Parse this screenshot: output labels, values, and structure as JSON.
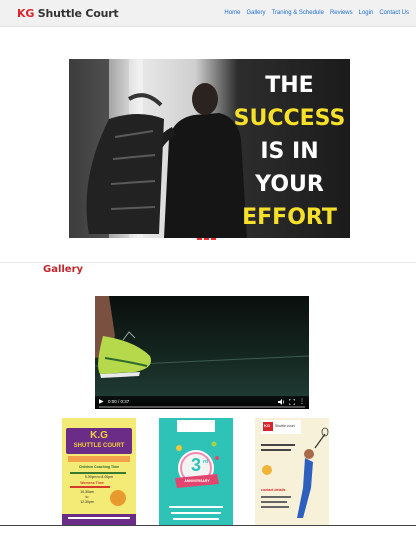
{
  "navbar": {
    "brand_kg": "KG",
    "brand_rest": " Shuttle Court",
    "links": [
      "Home",
      "Gallery",
      "Traning & Schedule",
      "Reviews",
      "Login",
      "Contact Us"
    ]
  },
  "hero": {
    "line1": "THE",
    "line2": "SUCCESS",
    "line3": "IS IN",
    "line4": "YOUR",
    "line5": "EFFORT"
  },
  "gallery": {
    "heading": "Gallery",
    "video": {
      "time": "0:00 / 0:37",
      "progress": 0
    },
    "poster1": {
      "title": "K.G",
      "subtitle": "SHUTTLE COURT",
      "line1": "Children Coaching Time",
      "line2": "5.30pm to 8.00pm",
      "line3": "Womens Time",
      "line4": "10.30am",
      "line5": "to",
      "line6": "12.30pm"
    },
    "poster2": {
      "number": "3",
      "suffix": "rd",
      "ribbon": "ANNIVERSARY"
    },
    "poster3": {
      "brand": "KG",
      "name": "Shuttle court",
      "contact_heading": "contact details"
    }
  },
  "colors": {
    "accent": "#c0262d",
    "link": "#1f6fd1",
    "hero_yellow": "#f7e02a"
  }
}
